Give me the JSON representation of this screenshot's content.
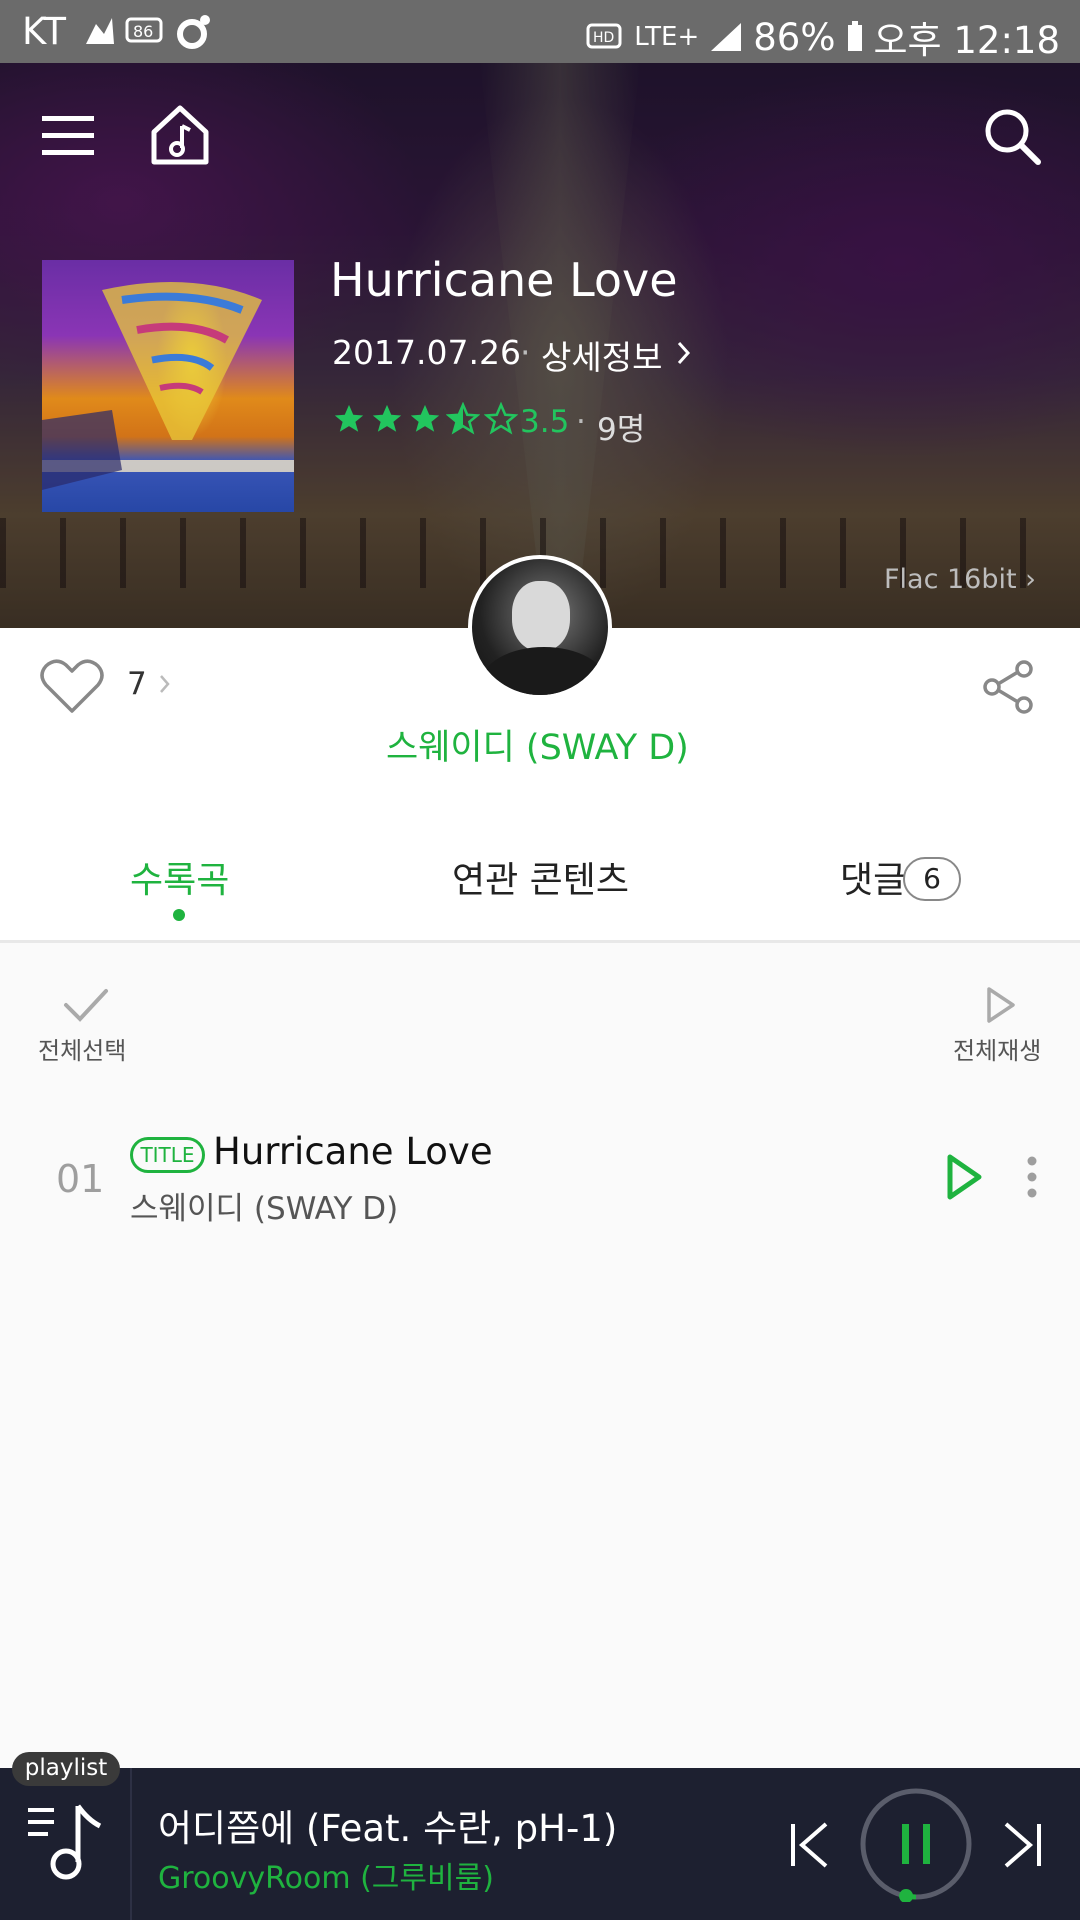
{
  "status_bar": {
    "carrier": "KT",
    "network": "LTE+",
    "battery": "86%",
    "time": "오후 12:18"
  },
  "album": {
    "title": "Hurricane Love",
    "date": "2017.07.26",
    "separator": "·",
    "detail_link": "상세정보",
    "rating": 3.5,
    "rating_text": "3.5",
    "rating_count": "9명",
    "quality": "Flac 16bit ›",
    "likes": "7",
    "artist": "스웨이디 (SWAY D)"
  },
  "tabs": [
    {
      "label": "수록곡"
    },
    {
      "label": "연관 콘텐츠"
    },
    {
      "label": "댓글",
      "badge": "6"
    }
  ],
  "list_controls": {
    "select_all": "전체선택",
    "play_all": "전체재생"
  },
  "tracks": [
    {
      "number": "01",
      "badge": "TITLE",
      "title": "Hurricane Love",
      "artist": "스웨이디 (SWAY D)"
    }
  ],
  "player": {
    "playlist_label": "playlist",
    "title": "어디쯤에 (Feat. 수란, pH-1)",
    "artist": "GroovyRoom (그루비룸)",
    "progress": 0.03
  },
  "colors": {
    "accent": "#1fb33f",
    "player_bg": "#1d2030",
    "status_bar": "#6b6b6b"
  }
}
